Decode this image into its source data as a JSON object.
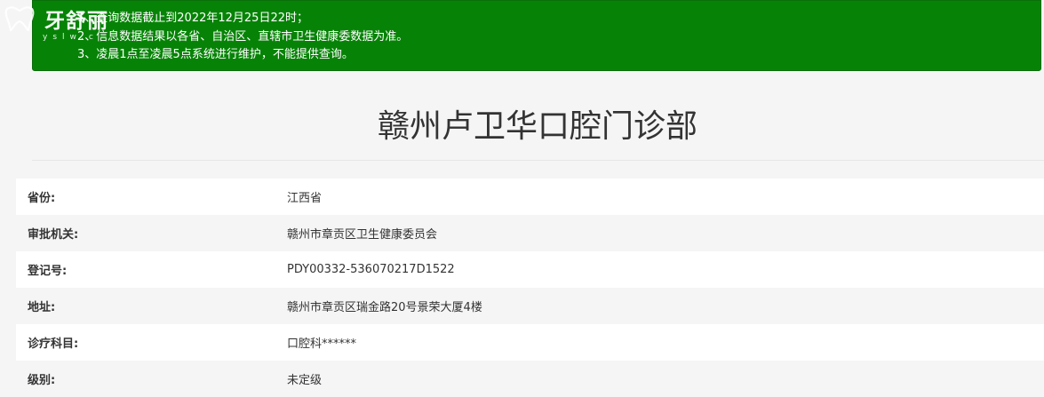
{
  "notice": {
    "lines": [
      "1、查询数据截止到2022年12月25日22时；",
      "2、信息数据结果以各省、自治区、直辖市卫生健康委数据为准。",
      "3、凌晨1点至凌晨5点系统进行维护，不能提供查询。"
    ],
    "bg_color": "#068306"
  },
  "logo": {
    "name": "牙舒丽",
    "sub": "yslw.c"
  },
  "page": {
    "title": "赣州卢卫华口腔门诊部"
  },
  "info": {
    "rows": [
      {
        "label": "省份:",
        "value": "江西省"
      },
      {
        "label": "审批机关:",
        "value": "赣州市章贡区卫生健康委员会"
      },
      {
        "label": "登记号:",
        "value": "PDY00332-536070217D1522"
      },
      {
        "label": "地址:",
        "value": "赣州市章贡区瑞金路20号景荣大厦4楼"
      },
      {
        "label": "诊疗科目:",
        "value": "口腔科******"
      },
      {
        "label": "级别:",
        "value": "未定级"
      }
    ]
  }
}
